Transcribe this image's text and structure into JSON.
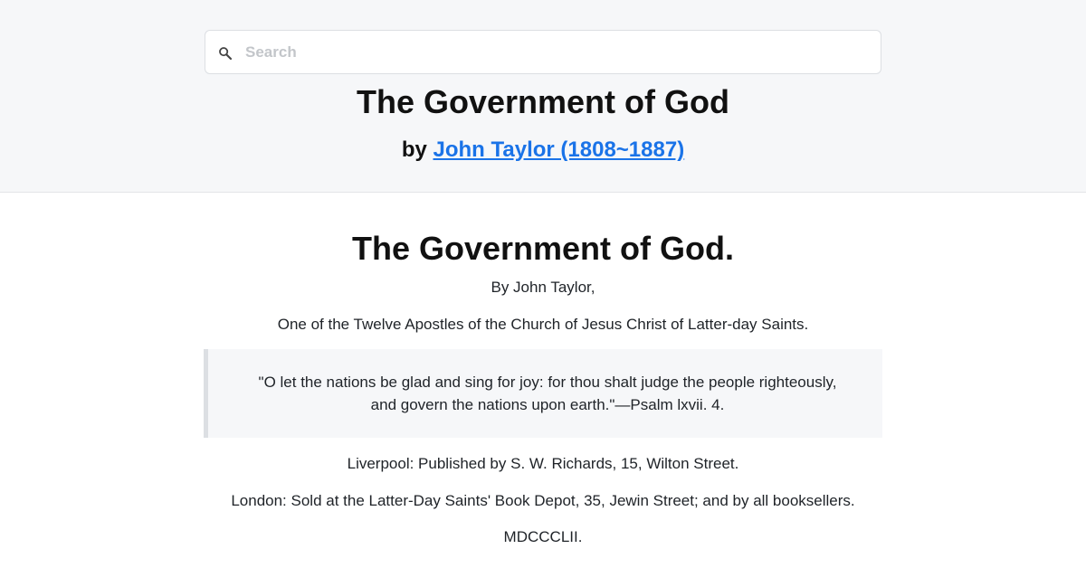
{
  "search": {
    "placeholder": "Search",
    "icon": "search-icon"
  },
  "header": {
    "title": "The Government of God",
    "by_prefix": "by",
    "author_link": "John Taylor (1808~1887)",
    "link_color": "#1a73e8"
  },
  "document": {
    "title": "The Government of God.",
    "byline": "By John Taylor,",
    "affiliation": "One of the Twelve Apostles of the Church of Jesus Christ of Latter-day Saints.",
    "epigraph": "\"O let the nations be glad and sing for joy: for thou shalt judge the people righteously, and govern the nations upon earth.\"—Psalm lxvii. 4.",
    "publisher_liverpool": "Liverpool: Published by S. W. Richards, 15, Wilton Street.",
    "publisher_london": "London: Sold at the Latter-Day Saints' Book Depot, 35, Jewin Street; and by all booksellers.",
    "year": "MDCCCLII."
  }
}
